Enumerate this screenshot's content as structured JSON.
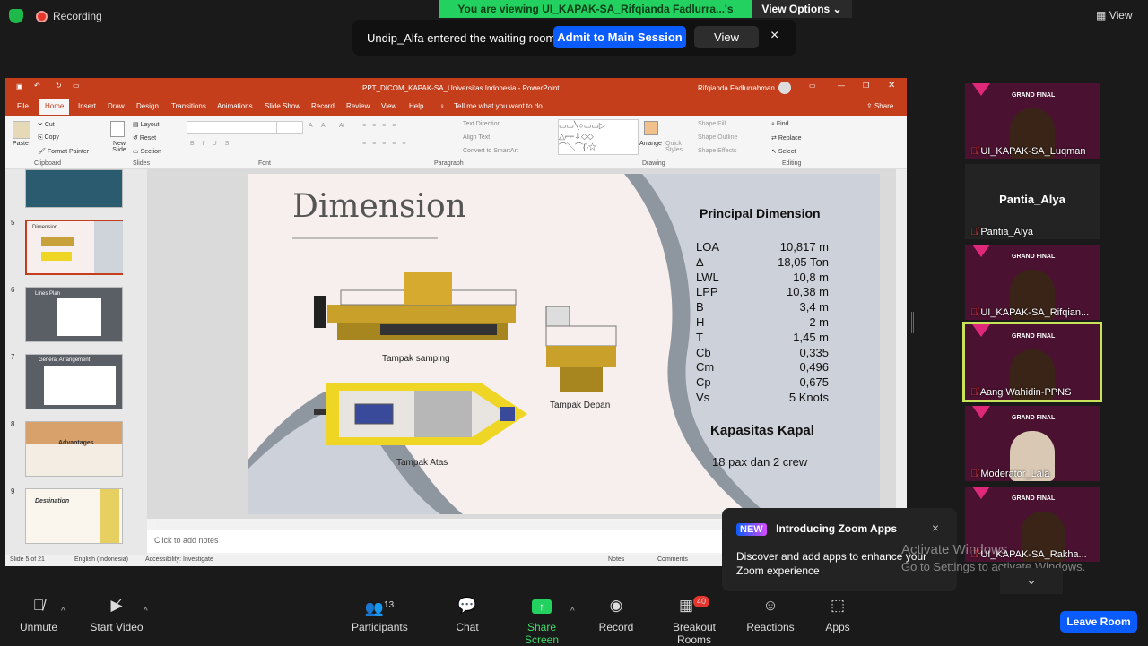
{
  "topbar": {
    "recording": "Recording",
    "viewing": "You are viewing UI_KAPAK-SA_Rifqianda Fadlurra...'s screen",
    "view_options": "View Options",
    "view": "View"
  },
  "notification": {
    "text": "Undip_Alfa entered the waiting room",
    "admit": "Admit to Main Session",
    "view": "View",
    "close": "×"
  },
  "ppt": {
    "title": "PPT_DICOM_KAPAK-SA_Universitas Indonesia  -  PowerPoint",
    "user": "Rifqianda Fadlurrahman",
    "tabs": [
      "File",
      "Home",
      "Insert",
      "Draw",
      "Design",
      "Transitions",
      "Animations",
      "Slide Show",
      "Record",
      "Review",
      "View",
      "Help"
    ],
    "tell_me": "Tell me what you want to do",
    "share": "Share",
    "ribbon": {
      "paste": "Paste",
      "cut": "Cut",
      "copy": "Copy",
      "format_painter": "Format Painter",
      "clipboard": "Clipboard",
      "new_slide": "New Slide",
      "layout": "Layout",
      "reset": "Reset",
      "section": "Section",
      "slides": "Slides",
      "font": "Font",
      "paragraph": "Paragraph",
      "text_direction": "Text Direction",
      "align_text": "Align Text",
      "convert_smartart": "Convert to SmartArt",
      "arrange": "Arrange",
      "quick_styles": "Quick Styles",
      "shape_fill": "Shape Fill",
      "shape_outline": "Shape Outline",
      "shape_effects": "Shape Effects",
      "drawing": "Drawing",
      "find": "Find",
      "replace": "Replace",
      "select": "Select",
      "editing": "Editing"
    },
    "thumbs": [
      {
        "num": "5",
        "title": "Dimension"
      },
      {
        "num": "6",
        "title": "Lines Plan"
      },
      {
        "num": "7",
        "title": "General Arrangement"
      },
      {
        "num": "8",
        "title": "Advantages"
      },
      {
        "num": "9",
        "title": "Destination"
      }
    ],
    "notes_placeholder": "Click to add notes",
    "status": {
      "slide": "Slide 5 of 21",
      "language": "English (Indonesia)",
      "accessibility": "Accessibility: Investigate",
      "notes": "Notes",
      "comments": "Comments"
    }
  },
  "slide": {
    "title": "Dimension",
    "side_label": "Tampak samping",
    "front_label": "Tampak Depan",
    "top_label": "Tampak Atas",
    "principal_title": "Principal Dimension",
    "dimensions": [
      {
        "k": "LOA",
        "v": "10,817 m"
      },
      {
        "k": "Δ",
        "v": "18,05 Ton"
      },
      {
        "k": "LWL",
        "v": "10,8 m"
      },
      {
        "k": "LPP",
        "v": "10,38 m"
      },
      {
        "k": "B",
        "v": "3,4 m"
      },
      {
        "k": "H",
        "v": "2 m"
      },
      {
        "k": "T",
        "v": "1,45 m"
      },
      {
        "k": "Cb",
        "v": "0,335"
      },
      {
        "k": "Cm",
        "v": "0,496"
      },
      {
        "k": "Cp",
        "v": "0,675"
      },
      {
        "k": "Vs",
        "v": "5 Knots"
      }
    ],
    "capacity_title": "Kapasitas Kapal",
    "capacity": "18 pax dan 2 crew"
  },
  "participants": [
    {
      "name": "UI_KAPAK-SA_Luqman",
      "video": true
    },
    {
      "name": "Pantia_Alya",
      "video": false,
      "big": "Pantia_Alya"
    },
    {
      "name": "UI_KAPAK-SA_Rifqian...",
      "video": true
    },
    {
      "name": "Aang Wahidin-PPNS",
      "video": true,
      "active": true
    },
    {
      "name": "Moderator_Lala",
      "video": true
    },
    {
      "name": "UI_KAPAK-SA_Rakha...",
      "video": true
    }
  ],
  "tile_badge": "GRAND FINAL",
  "zoom_apps": {
    "badge": "NEW",
    "title": "Introducing Zoom Apps",
    "body": "Discover and add apps to enhance your Zoom experience",
    "close": "×"
  },
  "activate": {
    "title": "Activate Windows",
    "sub": "Go to Settings to activate Windows."
  },
  "toolbar": {
    "unmute": "Unmute",
    "start_video": "Start Video",
    "participants": "Participants",
    "participants_count": "13",
    "chat": "Chat",
    "share_screen": "Share Screen",
    "record": "Record",
    "breakout": "Breakout Rooms",
    "breakout_count": "40",
    "reactions": "Reactions",
    "apps": "Apps",
    "leave": "Leave Room"
  }
}
